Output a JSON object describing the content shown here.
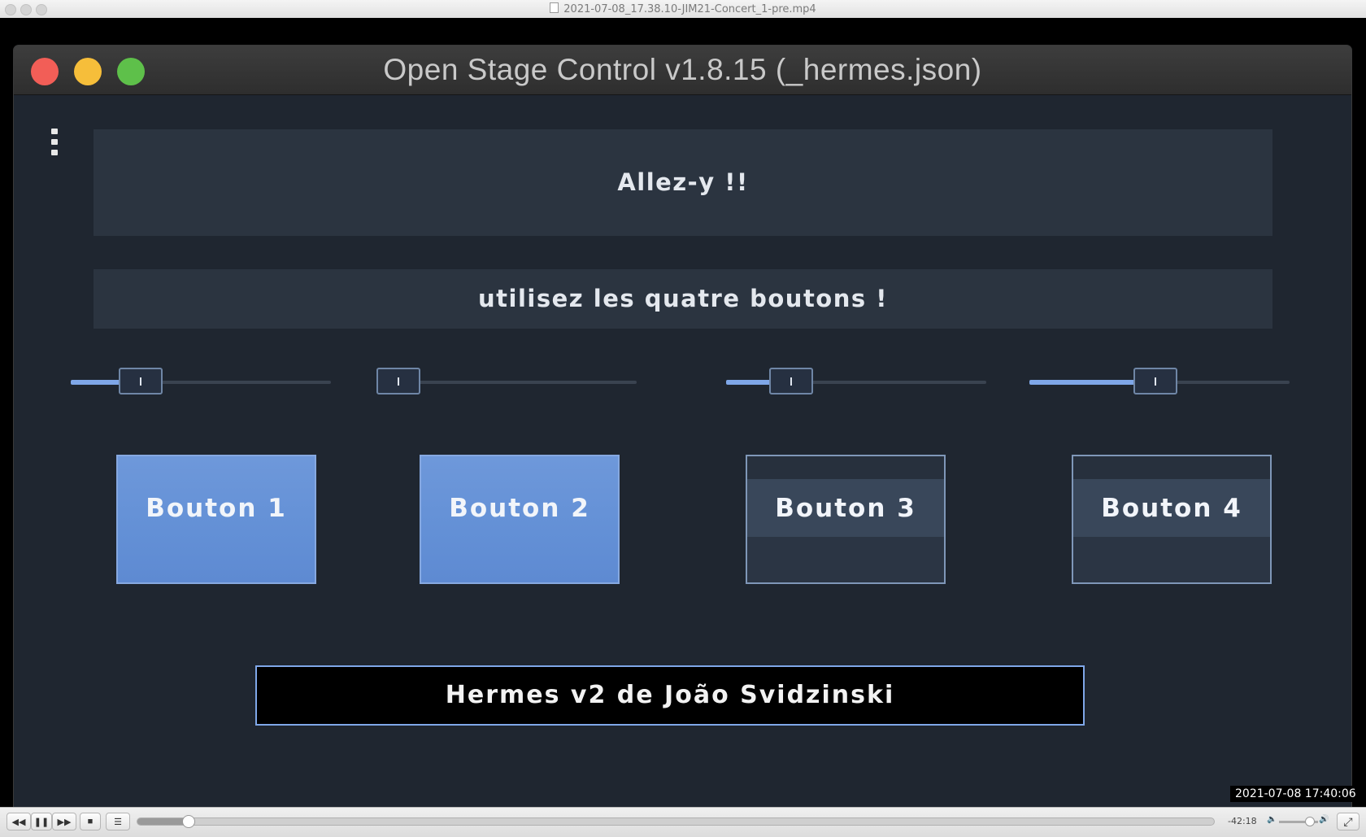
{
  "player": {
    "file_name": "2021-07-08_17.38.10-JIM21-Concert_1-pre.mp4",
    "remaining_time": "-42:18",
    "progress": 0.047,
    "volume": 0.78,
    "controls": {
      "rewind_glyph": "◀◀",
      "pause_glyph": "❚❚",
      "forward_glyph": "▶▶",
      "stop_glyph": "■",
      "playlist_glyph": "☰",
      "volume_low_glyph": "🔈",
      "volume_high_glyph": "🔊",
      "fullscreen_glyph": "⤢"
    }
  },
  "osc": {
    "window_title": "Open Stage Control v1.8.15 (_hermes.json)",
    "panel_top_text": "Allez-y !!",
    "panel_instruction_text": "utilisez les quatre boutons !",
    "sliders": [
      {
        "value": 0.22
      },
      {
        "value": 0.0
      },
      {
        "value": 0.2
      },
      {
        "value": 0.48
      }
    ],
    "buttons": [
      {
        "label": "Bouton 1",
        "state": "on"
      },
      {
        "label": "Bouton 2",
        "state": "on"
      },
      {
        "label": "Bouton 3",
        "state": "off"
      },
      {
        "label": "Bouton 4",
        "state": "off"
      }
    ],
    "credit_text": "Hermes v2 de João Svidzinski"
  },
  "video_timestamp": "2021-07-08  17:40:06",
  "colors": {
    "accent": "#7fa7e8",
    "button_on": "#6390d6",
    "panel_bg": "#2b3440",
    "app_bg": "#1f2630",
    "close": "#f25e57",
    "minimize": "#f6be3a",
    "zoom": "#5ec04a"
  }
}
